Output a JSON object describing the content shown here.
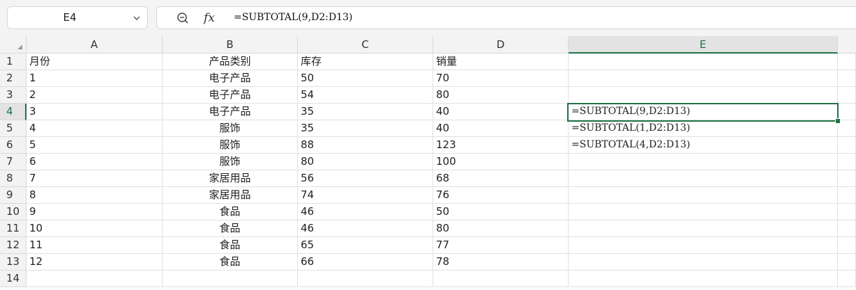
{
  "name_box": {
    "value": "E4"
  },
  "formula_bar": {
    "zoom_icon": "zoom-icon",
    "fx_label": "fx",
    "formula": "=SUBTOTAL(9,D2:D13)"
  },
  "columns": [
    "A",
    "B",
    "C",
    "D",
    "E"
  ],
  "rows": [
    {
      "num": "1",
      "a": "月份",
      "b": "产品类别",
      "c": "库存",
      "d": "销量",
      "e": ""
    },
    {
      "num": "2",
      "a": "1",
      "b": "电子产品",
      "c": "50",
      "d": "70",
      "e": ""
    },
    {
      "num": "3",
      "a": "2",
      "b": "电子产品",
      "c": "54",
      "d": "80",
      "e": ""
    },
    {
      "num": "4",
      "a": "3",
      "b": "电子产品",
      "c": "35",
      "d": "40",
      "e": "=SUBTOTAL(9,D2:D13)"
    },
    {
      "num": "5",
      "a": "4",
      "b": "服饰",
      "c": "35",
      "d": "40",
      "e": "=SUBTOTAL(1,D2:D13)"
    },
    {
      "num": "6",
      "a": "5",
      "b": "服饰",
      "c": "88",
      "d": "123",
      "e": "=SUBTOTAL(4,D2:D13)"
    },
    {
      "num": "7",
      "a": "6",
      "b": "服饰",
      "c": "80",
      "d": "100",
      "e": ""
    },
    {
      "num": "8",
      "a": "7",
      "b": "家居用品",
      "c": "56",
      "d": "68",
      "e": ""
    },
    {
      "num": "9",
      "a": "8",
      "b": "家居用品",
      "c": "74",
      "d": "76",
      "e": ""
    },
    {
      "num": "10",
      "a": "9",
      "b": "食品",
      "c": "46",
      "d": "50",
      "e": ""
    },
    {
      "num": "11",
      "a": "10",
      "b": "食品",
      "c": "46",
      "d": "80",
      "e": ""
    },
    {
      "num": "12",
      "a": "11",
      "b": "食品",
      "c": "65",
      "d": "77",
      "e": ""
    },
    {
      "num": "13",
      "a": "12",
      "b": "食品",
      "c": "66",
      "d": "78",
      "e": ""
    },
    {
      "num": "14",
      "a": "",
      "b": "",
      "c": "",
      "d": "",
      "e": ""
    }
  ],
  "selection": {
    "column": "E",
    "row": "4",
    "accent_color": "#217346"
  }
}
